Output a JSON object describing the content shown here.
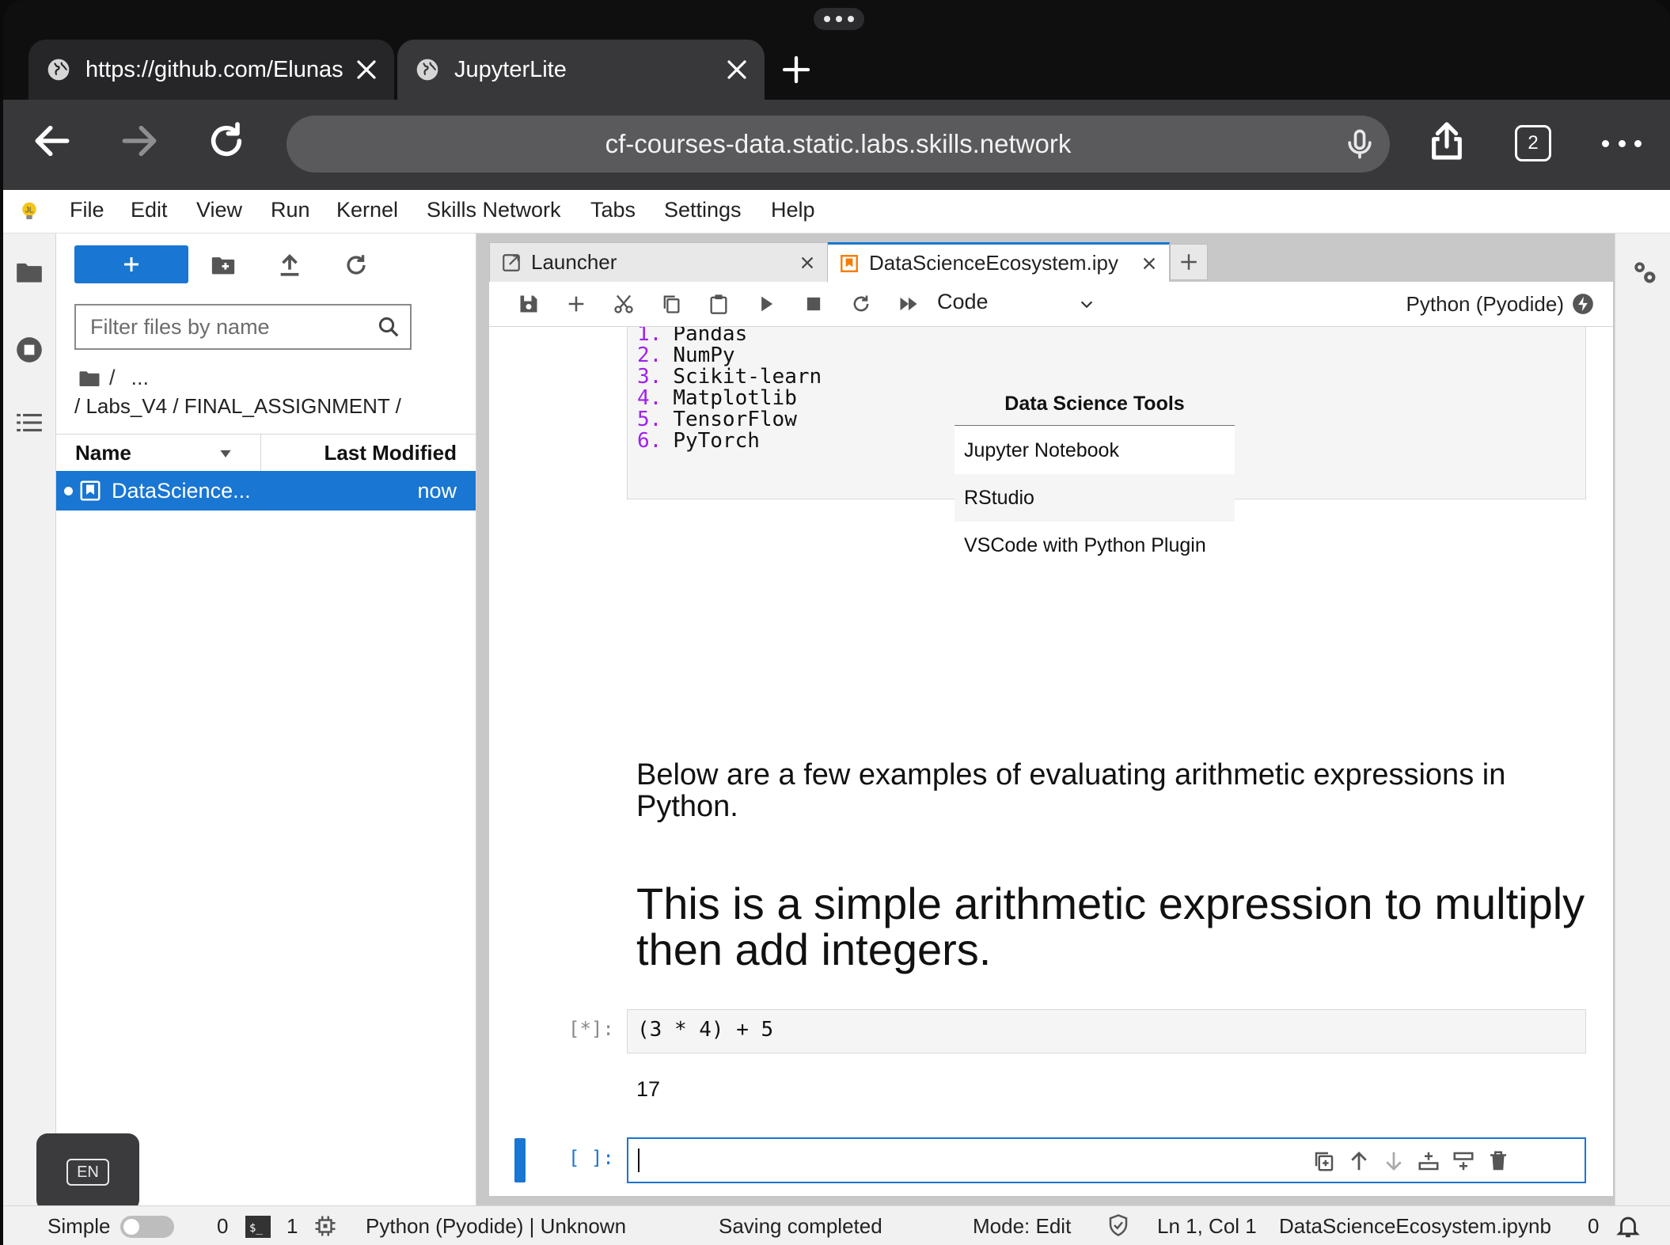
{
  "browser": {
    "tabs": [
      {
        "title": "https://github.com/Elunas",
        "active": false
      },
      {
        "title": "JupyterLite",
        "active": true
      }
    ],
    "url": "cf-courses-data.static.labs.skills.network",
    "tab_count": "2"
  },
  "menubar": {
    "items": [
      "File",
      "Edit",
      "View",
      "Run",
      "Kernel",
      "Skills Network",
      "Tabs",
      "Settings",
      "Help"
    ]
  },
  "filebrowser": {
    "filter_placeholder": "Filter files by name",
    "crumb_root": "/",
    "crumb_more": "...",
    "path": "/ Labs_V4 / FINAL_ASSIGNMENT /",
    "col_name": "Name",
    "col_modified": "Last Modified",
    "files": [
      {
        "name": "DataScience...",
        "modified": "now",
        "selected": true
      }
    ]
  },
  "doc_tabs": [
    {
      "label": "Launcher",
      "icon": "launcher-icon"
    },
    {
      "label": "DataScienceEcosystem.ipy",
      "icon": "notebook-icon"
    }
  ],
  "toolbar": {
    "cell_type": "Code",
    "kernel": "Python (Pyodide)"
  },
  "notebook": {
    "libraries": [
      {
        "num": "1.",
        "name": "Pandas"
      },
      {
        "num": "2.",
        "name": "NumPy"
      },
      {
        "num": "3.",
        "name": "Scikit-learn"
      },
      {
        "num": "4.",
        "name": "Matplotlib"
      },
      {
        "num": "5.",
        "name": "TensorFlow"
      },
      {
        "num": "6.",
        "name": "PyTorch"
      }
    ],
    "tools_table": {
      "header": "Data Science Tools",
      "rows": [
        "Jupyter Notebook",
        "RStudio",
        "VSCode with Python Plugin"
      ]
    },
    "paragraph": "Below are a few examples of evaluating arithmetic expressions in Python.",
    "heading": "This is a simple arithmetic expression to multiply then add integers.",
    "code_cell": {
      "prompt": "[*]:",
      "source": "(3 * 4) + 5",
      "output": "17"
    },
    "empty_cell": {
      "prompt": "[ ]:",
      "source": ""
    }
  },
  "ime": {
    "label": "EN"
  },
  "statusbar": {
    "mode_label": "Simple",
    "terminals": "0",
    "kernels": "1",
    "kernel_status": "Python (Pyodide) | Unknown",
    "save_status": "Saving completed",
    "mode": "Mode: Edit",
    "cursor": "Ln 1, Col 1",
    "filename": "DataScienceEcosystem.ipynb",
    "notifications": "0"
  },
  "colors": {
    "accent": "#1976d2",
    "list_number": "#a020f0",
    "browser_chrome": "#38383a"
  }
}
